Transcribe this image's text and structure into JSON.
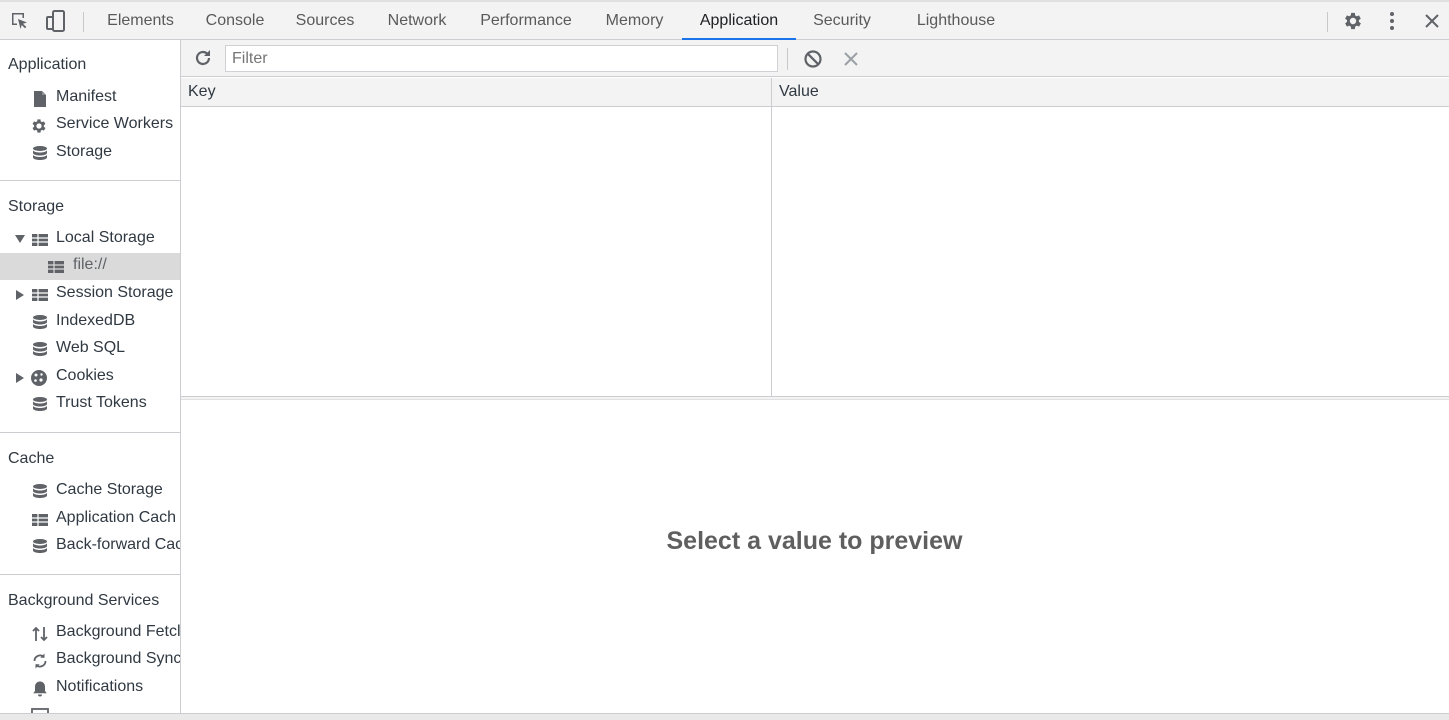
{
  "tabs": [
    "Elements",
    "Console",
    "Sources",
    "Network",
    "Performance",
    "Memory",
    "Application",
    "Security",
    "Lighthouse"
  ],
  "active_tab": "Application",
  "sidebar": {
    "application": {
      "title": "Application",
      "items": [
        "Manifest",
        "Service Workers",
        "Storage"
      ]
    },
    "storage": {
      "title": "Storage",
      "items": [
        "Local Storage",
        "file://",
        "Session Storage",
        "IndexedDB",
        "Web SQL",
        "Cookies",
        "Trust Tokens"
      ]
    },
    "cache": {
      "title": "Cache",
      "items": [
        "Cache Storage",
        "Application Cach",
        "Back-forward Cac"
      ]
    },
    "background": {
      "title": "Background Services",
      "items": [
        "Background Fetcl",
        "Background Sync",
        "Notifications"
      ]
    }
  },
  "toolbar": {
    "filter_placeholder": "Filter"
  },
  "grid": {
    "key_header": "Key",
    "value_header": "Value"
  },
  "preview": {
    "message": "Select a value to preview"
  },
  "colors": {
    "accent": "#1a73e8",
    "selected_bg": "#dadada",
    "icon": "#5f6368"
  }
}
